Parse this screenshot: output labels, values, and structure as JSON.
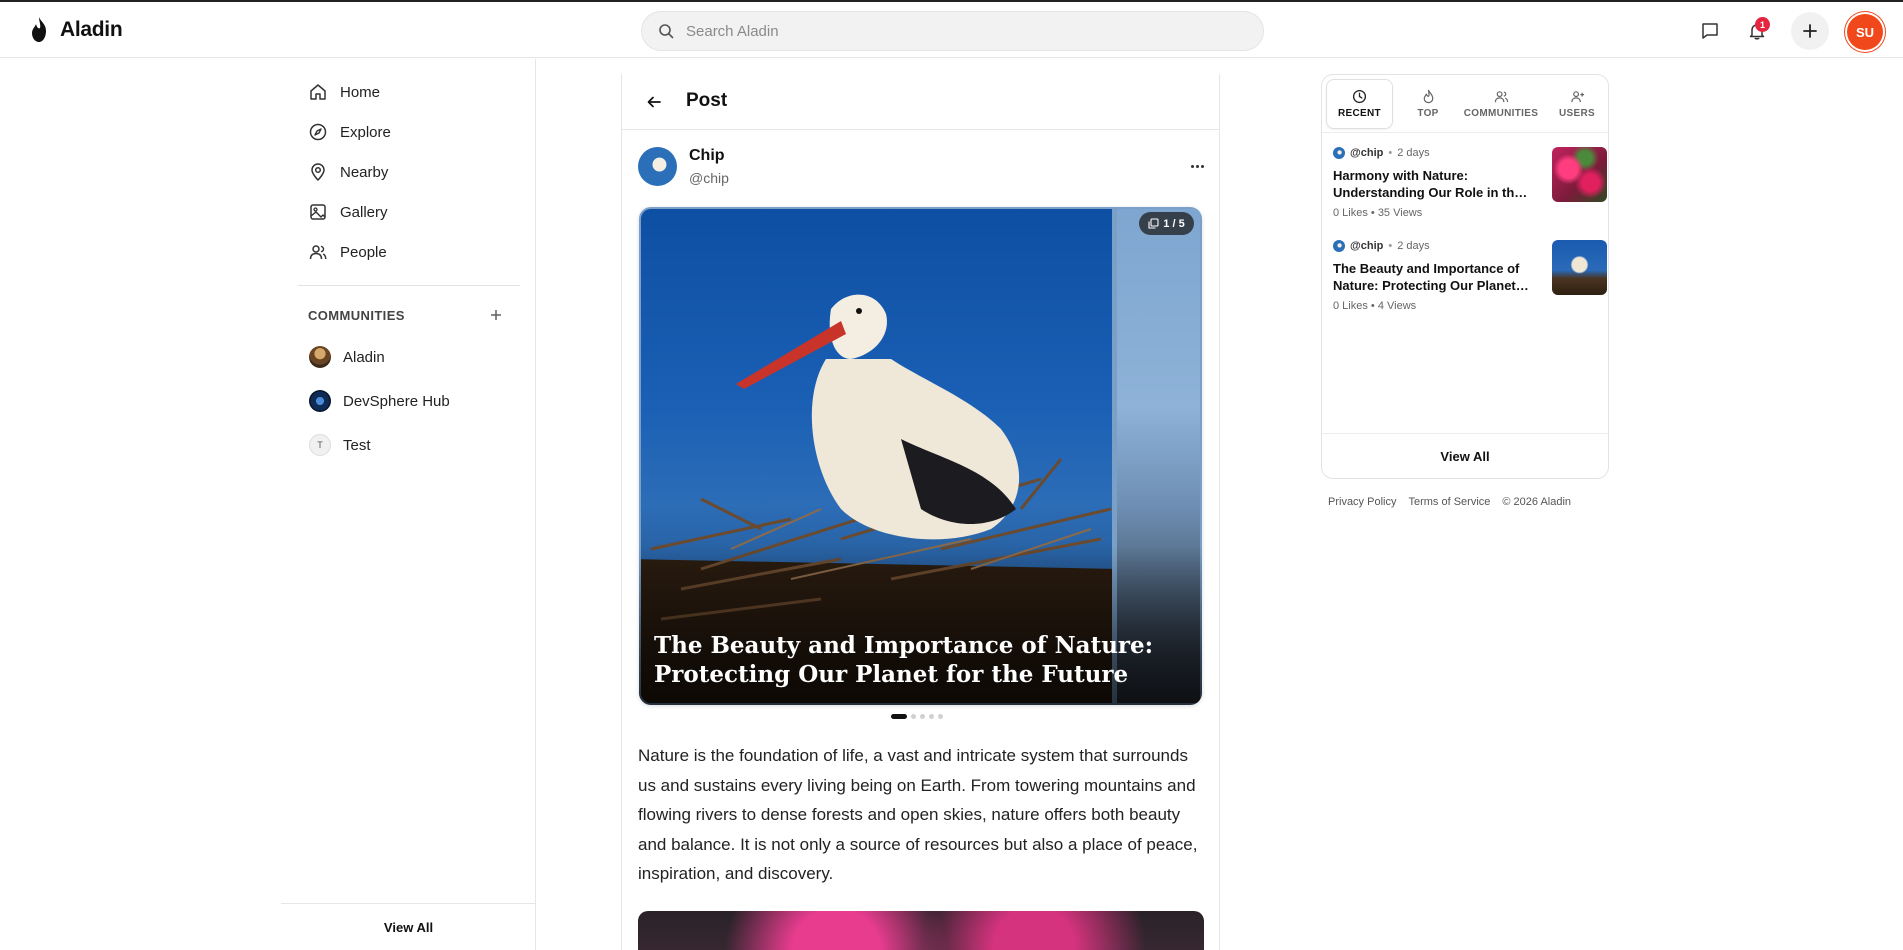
{
  "header": {
    "app_name": "Aladin",
    "search_placeholder": "Search Aladin",
    "notification_count": "1",
    "user_initials": "SU"
  },
  "sidebar": {
    "nav": [
      {
        "label": "Home",
        "icon": "home-icon"
      },
      {
        "label": "Explore",
        "icon": "compass-icon"
      },
      {
        "label": "Nearby",
        "icon": "map-pin-icon"
      },
      {
        "label": "Gallery",
        "icon": "image-icon"
      },
      {
        "label": "People",
        "icon": "users-icon"
      }
    ],
    "communities_heading": "COMMUNITIES",
    "communities": [
      {
        "label": "Aladin"
      },
      {
        "label": "DevSphere Hub"
      },
      {
        "label": "Test",
        "initial": "T"
      }
    ],
    "view_all": "View All"
  },
  "post": {
    "header_title": "Post",
    "author_name": "Chip",
    "author_handle": "@chip",
    "image_counter": "1 / 5",
    "image_caption": "The Beauty and Importance of Nature: Protecting Our Planet for the Future",
    "body": "Nature is the foundation of life, a vast and intricate system that surrounds us and sustains every living being on Earth. From towering mountains and flowing rivers to dense forests and open skies, nature offers both beauty and balance. It is not only a source of resources but also a place of peace, inspiration, and discovery.",
    "total_images": 5,
    "active_image": 1
  },
  "right_panel": {
    "tabs": [
      {
        "label": "RECENT",
        "icon": "clock-icon",
        "active": true
      },
      {
        "label": "TOP",
        "icon": "flame-icon",
        "active": false
      },
      {
        "label": "COMMUNITIES",
        "icon": "users-icon",
        "active": false
      },
      {
        "label": "USERS",
        "icon": "user-plus-icon",
        "active": false
      }
    ],
    "items": [
      {
        "handle": "@chip",
        "separator": "•",
        "time": "2 days",
        "title": "Harmony with Nature: Understanding Our Role in the Natural World",
        "stats": "0 Likes • 35 Views"
      },
      {
        "handle": "@chip",
        "separator": "•",
        "time": "2 days",
        "title": "The Beauty and Importance of Nature: Protecting Our Planet for the Future",
        "stats": "0 Likes • 4 Views"
      }
    ],
    "view_all": "View All"
  },
  "footer": {
    "privacy": "Privacy Policy",
    "terms": "Terms of Service",
    "copyright": "© 2026 Aladin"
  },
  "colors": {
    "avatar_bg": "#f0481b",
    "badge_bg": "#e5253f"
  }
}
